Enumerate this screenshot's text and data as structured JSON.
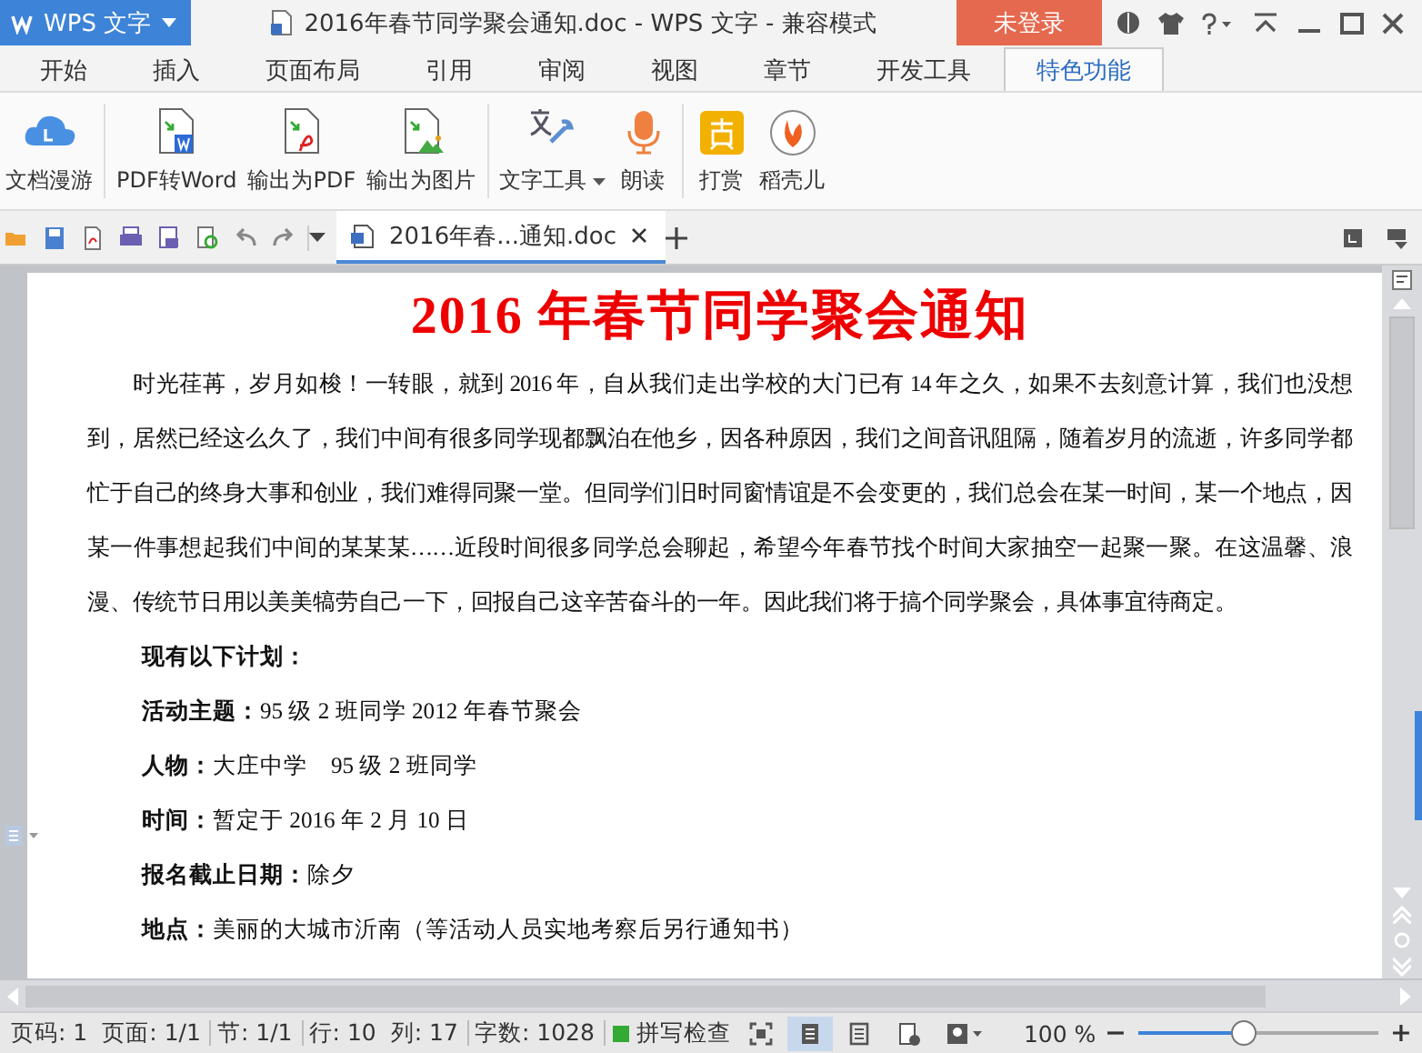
{
  "app_menu": {
    "label": "WPS 文字"
  },
  "window": {
    "title": "2016年春节同学聚会通知.doc - WPS 文字 - 兼容模式",
    "login_button": "未登录"
  },
  "ribbon_tabs": [
    {
      "label": "开始",
      "selected": false
    },
    {
      "label": "插入",
      "selected": false
    },
    {
      "label": "页面布局",
      "selected": false
    },
    {
      "label": "引用",
      "selected": false
    },
    {
      "label": "审阅",
      "selected": false
    },
    {
      "label": "视图",
      "selected": false
    },
    {
      "label": "章节",
      "selected": false
    },
    {
      "label": "开发工具",
      "selected": false
    },
    {
      "label": "特色功能",
      "selected": true
    }
  ],
  "ribbon_groups": [
    [
      {
        "label": "文档漫游",
        "dropdown": false
      }
    ],
    [
      {
        "label": "PDF转Word",
        "dropdown": false
      },
      {
        "label": "输出为PDF",
        "dropdown": false
      },
      {
        "label": "输出为图片",
        "dropdown": false
      }
    ],
    [
      {
        "label": "文字工具",
        "dropdown": true
      },
      {
        "label": "朗读",
        "dropdown": false
      }
    ],
    [
      {
        "label": "打赏",
        "dropdown": false
      },
      {
        "label": "稻壳儿",
        "dropdown": false
      }
    ]
  ],
  "doc_tabs": [
    {
      "label": "2016年春...通知.doc",
      "selected": true
    }
  ],
  "document": {
    "title": "2016 年春节同学聚会通知",
    "paragraph": "时光荏苒，岁月如梭！一转眼，就到 2016 年，自从我们走出学校的大门已有 14 年之久，如果不去刻意计算，我们也没想到，居然已经这么久了，我们中间有很多同学现都飘泊在他乡，因各种原因，我们之间音讯阻隔，随着岁月的流逝，许多同学都忙于自己的终身大事和创业，我们难得同聚一堂。但同学们旧时同窗情谊是不会变更的，我们总会在某一时间，某一个地点，因某一件事想起我们中间的某某某……近段时间很多同学总会聊起，希望今年春节找个时间大家抽空一起聚一聚。在这温馨、浪漫、传统节日用以美美犒劳自己一下，回报自己这辛苦奋斗的一年。因此我们将于搞个同学聚会，具体事宜待商定。",
    "plan_heading": "现有以下计划：",
    "plan_items": [
      {
        "label": "活动主题：",
        "value": "95 级 2 班同学 2012 年春节聚会"
      },
      {
        "label": "人物：",
        "value": "大庄中学　95 级 2 班同学"
      },
      {
        "label": "时间：",
        "value": "暂定于 2016 年 2 月 10 日"
      },
      {
        "label": "报名截止日期：",
        "value": "除夕"
      },
      {
        "label": "地点：",
        "value": "美丽的大城市沂南（等活动人员实地考察后另行通知书）"
      }
    ]
  },
  "status_bar": {
    "items": [
      "页码: 1",
      "页面: 1/1",
      "节: 1/1",
      "行: 10",
      "列: 17",
      "字数: 1028"
    ],
    "spell_check": "拼写检查",
    "views": [
      {
        "selected": false
      },
      {
        "selected": true
      },
      {
        "selected": false
      },
      {
        "selected": false
      },
      {
        "selected": false
      }
    ],
    "zoom": "100 %",
    "zoom_slider": {
      "level": 0.44
    }
  }
}
